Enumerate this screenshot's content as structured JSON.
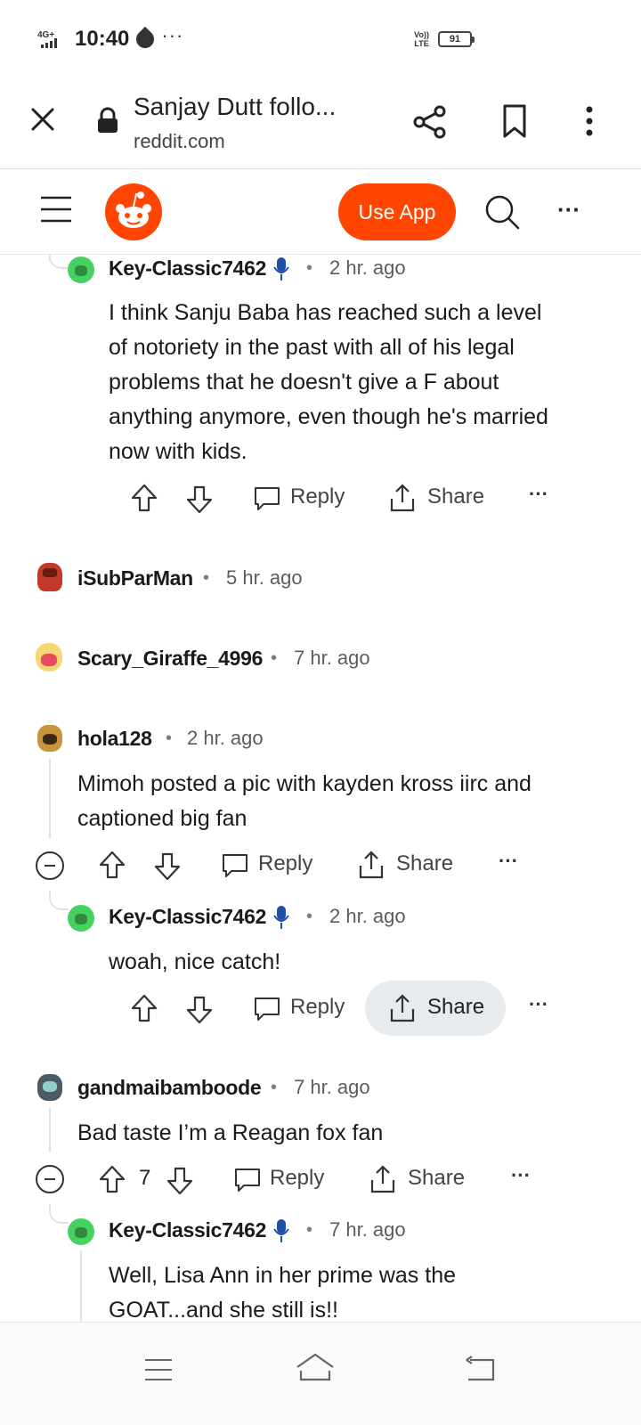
{
  "status_bar": {
    "network": "4G+",
    "time": "10:40",
    "more": "···",
    "volte": "Vo))\nLTE",
    "battery": "91"
  },
  "browser": {
    "title": "Sanjay Dutt follo...",
    "url": "reddit.com"
  },
  "reddit_nav": {
    "use_app": "Use App",
    "more": "···"
  },
  "comments": [
    {
      "author": "Key-Classic7462",
      "time": "2 hr. ago",
      "dot": "•",
      "body": [
        "I think Sanju Baba has reached such a level",
        "of notoriety in the past with all of his legal",
        "problems that he doesn't give a F about",
        "anything anymore, even though he's married",
        "now with kids."
      ],
      "reply": "Reply",
      "share": "Share",
      "more": "···"
    },
    {
      "author": "iSubParMan",
      "time": "5 hr. ago",
      "dot": "•"
    },
    {
      "author": "Scary_Giraffe_4996",
      "time": "7 hr. ago",
      "dot": "•"
    },
    {
      "author": "hola128",
      "time": "2 hr. ago",
      "dot": "•",
      "body": [
        "Mimoh posted a pic with kayden kross iirc and",
        "captioned big fan"
      ],
      "reply": "Reply",
      "share": "Share",
      "more": "···"
    },
    {
      "author": "Key-Classic7462",
      "time": "2 hr. ago",
      "dot": "•",
      "body": [
        "woah, nice catch!"
      ],
      "reply": "Reply",
      "share": "Share",
      "more": "···"
    },
    {
      "author": "gandmaibamboode",
      "time": "7 hr. ago",
      "dot": "•",
      "body": [
        "Bad taste I’m a Reagan fox fan"
      ],
      "score": "7",
      "reply": "Reply",
      "share": "Share",
      "more": "···"
    },
    {
      "author": "Key-Classic7462",
      "time": "7 hr. ago",
      "dot": "•",
      "body": [
        "Well, Lisa Ann in her prime was the",
        "GOAT...and she still is!!"
      ]
    }
  ],
  "colors": {
    "reddit_orange": "#ff4500",
    "mic_blue": "#1e4fa8",
    "avatar_green": "#46d160"
  }
}
